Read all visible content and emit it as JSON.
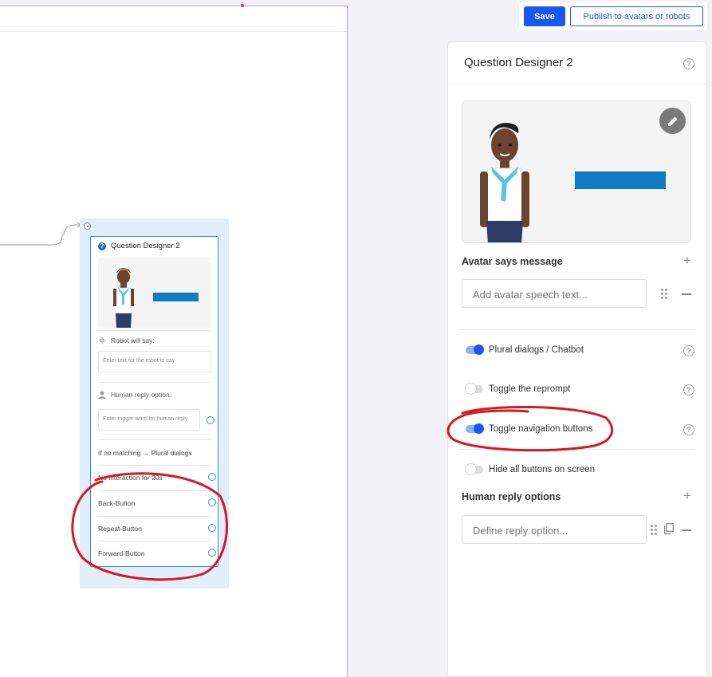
{
  "toolbar": {
    "save_label": "Save",
    "publish_label": "Publish to avatars or robots"
  },
  "node": {
    "title": "Question Designer 2",
    "robot_label": "Robot will say:",
    "robot_placeholder": "Enter text for the robot to say",
    "human_label": "Human reply option:",
    "human_placeholder": "Enter trigger word for human reply",
    "no_match": "If no matching → Plural dialogs",
    "no_interaction": "No interaction for 20s",
    "rows": [
      "Back-Button",
      "Repeat-Button",
      "Forward-Button"
    ]
  },
  "panel": {
    "title": "Question Designer 2",
    "avatar_section": "Avatar says message",
    "avatar_placeholder": "Add avatar speech text...",
    "toggles": [
      {
        "label": "Plural dialogs / Chatbot",
        "on": true
      },
      {
        "label": "Toggle the reprompt",
        "on": false
      },
      {
        "label": "Toggle navigation buttons",
        "on": true
      },
      {
        "label": "Hide all buttons on screen",
        "on": false
      }
    ],
    "human_section": "Human reply options",
    "reply_placeholder": "Define reply option..."
  },
  "colors": {
    "accent": "#1a56f0",
    "node_border": "#3a8fd6",
    "annotation": "#d8181f",
    "media_bar": "#0f7bc2"
  }
}
